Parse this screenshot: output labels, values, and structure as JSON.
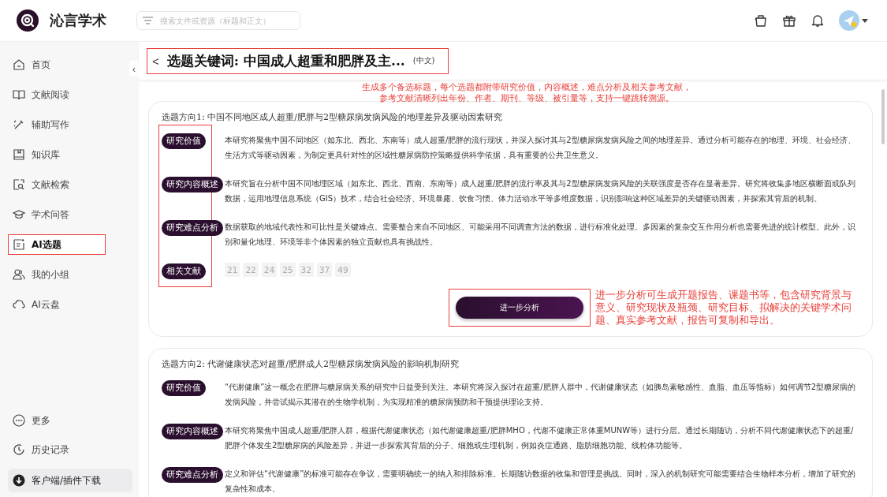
{
  "app": {
    "name": "沁言学术"
  },
  "search": {
    "placeholder": "搜索文件或资源（标题和正文）"
  },
  "sidebar": {
    "items": [
      {
        "label": "首页",
        "selected": false,
        "annotated": false
      },
      {
        "label": "文献阅读",
        "selected": false,
        "annotated": false
      },
      {
        "label": "辅助写作",
        "selected": false,
        "annotated": false
      },
      {
        "label": "知识库",
        "selected": false,
        "annotated": false
      },
      {
        "label": "文献检索",
        "selected": false,
        "annotated": false
      },
      {
        "label": "学术问答",
        "selected": false,
        "annotated": false
      },
      {
        "label": "AI选题",
        "selected": true,
        "annotated": true
      },
      {
        "label": "我的小组",
        "selected": false,
        "annotated": false
      },
      {
        "label": "AI云盘",
        "selected": false,
        "annotated": false
      }
    ],
    "bottom_items": [
      {
        "label": "更多",
        "kind": "link"
      },
      {
        "label": "历史记录",
        "kind": "link"
      },
      {
        "label": "客户端/插件下载",
        "kind": "download"
      }
    ],
    "collapse": "‹"
  },
  "page_header": {
    "back": "<",
    "title": "选题关键词: 中国成人超重和肥胖及主...",
    "language": "(中文)",
    "annotated": true
  },
  "annotations": {
    "top": [
      "生成多个备选标题，每个选题都附带研究价值，内容概述，难点分析及相关参考文献，",
      "参考文献清晰列出年份、作者、期刊、等级、被引量等，支持一键跳转溯源。"
    ],
    "right": "进一步分析可生成开题报告、课题书等，包含研究背景与意义、研究现状及瓶颈、研究目标、拟解决的关键学术问题、真实参考文献，报告可复制和导出。"
  },
  "directions": [
    {
      "title": "选题方向1: 中国不同地区成人超重/肥胖与2型糖尿病发病风险的地理差异及驱动因素研究",
      "labels_annotated": true,
      "sections": [
        {
          "label": "研究价值",
          "text": "本研究将聚焦中国不同地区（如东北、西北、东南等）成人超重/肥胖的流行现状，并深入探讨其与2型糖尿病发病风险之间的地理差异。通过分析可能存在的地理、环境、社会经济、生活方式等驱动因素，为制定更具针对性的区域性糖尿病防控策略提供科学依据，具有重要的公共卫生意义。"
        },
        {
          "label": "研究内容概述",
          "text": "本研究旨在分析中国不同地理区域（如东北、西北、西南、东南等）成人超重/肥胖的流行率及其与2型糖尿病发病风险的关联强度是否存在显著差异。研究将收集多地区横断面或队列数据，运用地理信息系统（GIS）技术，结合社会经济、环境暴露、饮食习惯、体力活动水平等多维度数据，识别影响这种区域差异的关键驱动因素，并探索其背后的机制。"
        },
        {
          "label": "研究难点分析",
          "text": "数据获取的地域代表性和可比性是关键难点。需要整合来自不同地区、可能采用不同调查方法的数据，进行标准化处理。多因素的复杂交互作用分析也需要先进的统计模型。此外，识别和量化地理、环境等非个体因素的独立贡献也具有挑战性。"
        }
      ],
      "references": {
        "label": "相关文献",
        "numbers": [
          "21",
          "22",
          "24",
          "25",
          "32",
          "37",
          "49"
        ]
      },
      "button": {
        "label": "进一步分析",
        "annotated": true
      }
    },
    {
      "title": "选题方向2: 代谢健康状态对超重/肥胖成人2型糖尿病发病风险的影响机制研究",
      "labels_annotated": false,
      "sections": [
        {
          "label": "研究价值",
          "text": "“代谢健康”这一概念在肥胖与糖尿病关系的研究中日益受到关注。本研究将深入探讨在超重/肥胖人群中，代谢健康状态（如胰岛素敏感性、血脂、血压等指标）如何调节2型糖尿病的发病风险，并尝试揭示其潜在的生物学机制，为实现精准的糖尿病预防和干预提供理论支持。"
        },
        {
          "label": "研究内容概述",
          "text": "本研究将聚焦中国成人超重/肥胖人群，根据代谢健康状态（如代谢健康超重/肥胖MHO，代谢不健康正常体重MUNW等）进行分层。通过长期随访，分析不同代谢健康状态下的超重/肥胖个体发生2型糖尿病的风险差异，并进一步探索其背后的分子、细胞或生理机制，例如炎症通路、脂肪细胞功能、线粒体功能等。"
        },
        {
          "label": "研究难点分析",
          "text": "定义和评估“代谢健康”的标准可能存在争议，需要明确统一的纳入和排除标准。长期随访数据的收集和管理是挑战。同时，深入的机制研究可能需要结合生物样本分析，增加了研究的复杂性和成本。"
        }
      ]
    }
  ]
}
